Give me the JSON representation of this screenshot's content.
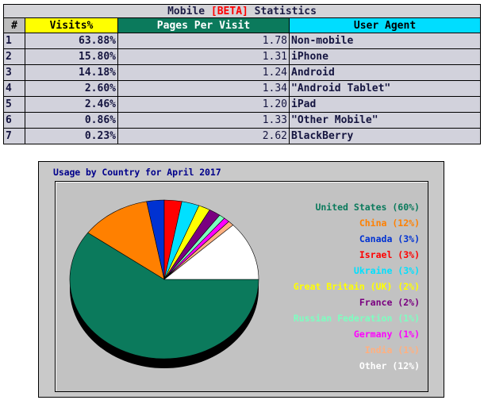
{
  "table": {
    "title_prefix": "Mobile ",
    "title_beta": "[BETA]",
    "title_suffix": " Statistics",
    "headers": {
      "num": "#",
      "visits": "Visits%",
      "pages": "Pages Per Visit",
      "agent": "User Agent"
    },
    "rows": [
      {
        "num": "1",
        "visits": "63.88%",
        "pages": "1.78",
        "agent": "Non-mobile"
      },
      {
        "num": "2",
        "visits": "15.80%",
        "pages": "1.31",
        "agent": "iPhone"
      },
      {
        "num": "3",
        "visits": "14.18%",
        "pages": "1.24",
        "agent": "Android"
      },
      {
        "num": "4",
        "visits": "2.60%",
        "pages": "1.34",
        "agent": "\"Android Tablet\""
      },
      {
        "num": "5",
        "visits": "2.46%",
        "pages": "1.20",
        "agent": "iPad"
      },
      {
        "num": "6",
        "visits": "0.86%",
        "pages": "1.33",
        "agent": "\"Other Mobile\""
      },
      {
        "num": "7",
        "visits": "0.23%",
        "pages": "2.62",
        "agent": "BlackBerry"
      }
    ]
  },
  "chart_data": {
    "type": "pie",
    "title": "Usage by Country for April 2017",
    "legend_position": "right",
    "slices": [
      {
        "label": "United States (60%)",
        "value": 60,
        "color": "#0b7a5c"
      },
      {
        "label": "China (12%)",
        "value": 12,
        "color": "#ff8000"
      },
      {
        "label": "Canada (3%)",
        "value": 3,
        "color": "#0032d2"
      },
      {
        "label": "Israel (3%)",
        "value": 3,
        "color": "#ff0000"
      },
      {
        "label": "Ukraine (3%)",
        "value": 3,
        "color": "#00e0ff"
      },
      {
        "label": "Great Britain (UK) (2%)",
        "value": 2,
        "color": "#ffff00"
      },
      {
        "label": "France (2%)",
        "value": 2,
        "color": "#7a0080"
      },
      {
        "label": "Russian Federation (1%)",
        "value": 1,
        "color": "#7dffc0"
      },
      {
        "label": "Germany (1%)",
        "value": 1,
        "color": "#ff00ff"
      },
      {
        "label": "India (1%)",
        "value": 1,
        "color": "#ffb080"
      },
      {
        "label": "Other (12%)",
        "value": 12,
        "color": "#ffffff"
      }
    ]
  }
}
